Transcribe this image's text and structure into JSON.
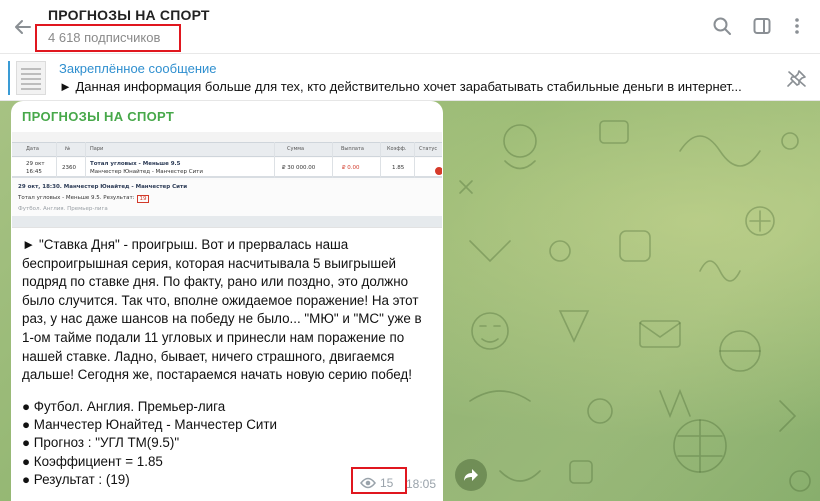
{
  "header": {
    "title": "ПРОГНОЗЫ НА СПОРТ",
    "subscribers": "4 618 подписчиков",
    "icons": [
      "arrow-left-icon",
      "search-icon",
      "sidebar-toggle-icon",
      "more-vertical-icon"
    ]
  },
  "pinned": {
    "title": "Закреплённое сообщение",
    "text": "► Данная информация больше для тех, кто действительно хочет зарабатывать стабильные деньги в интернет..."
  },
  "message": {
    "author": "ПРОГНОЗЫ НА СПОРТ",
    "photo": {
      "headers": [
        "Дата",
        "№",
        "Пари",
        "Сумма",
        "Выплата",
        "Коэфф.",
        "Статус"
      ],
      "row": {
        "date": "29 окт",
        "time": "16:45",
        "number": "2360",
        "bet": "Тотал угловых - Меньше 9.5",
        "match": "Манчестер Юнайтед - Манчестер Сити",
        "amount": "₽ 30 000.00",
        "payout": "₽ 0.00",
        "coef": "1.85"
      },
      "detail_title": "29 окт, 18:30. Манчестер Юнайтед - Манчестер Сити",
      "detail_bet": "Тотал угловых - Меньше 9.5. Результат:",
      "detail_result": "19",
      "detail_league": "Футбол. Англия. Премьер-лига"
    },
    "paragraph": "► \"Ставка Дня\" - проигрыш. Вот и прервалась наша беспроигрышная серия, которая насчитывала 5 выигрышей подряд по ставке дня. По факту, рано или поздно, это должно было случится. Так что, вполне ожидаемое поражение! На этот раз, у нас даже шансов на победу не было... \"МЮ\" и \"МС\" уже в 1-ом тайме подали 11 угловых и принесли нам поражение по нашей ставке. Ладно, бывает, ничего страшного, двигаемся дальше! Сегодня же, постараемся начать новую серию побед!",
    "list": [
      "● Футбол. Англия. Премьер-лига",
      "● Манчестер Юнайтед - Манчестер Сити",
      "● Прогноз : \"УГЛ ТМ(9.5)\"",
      "● Коэффициент = 1.85",
      "● Результат : (19)"
    ],
    "views": "15",
    "time": "18:05"
  },
  "colors": {
    "author": "#47a84a",
    "link": "#2f8fcf",
    "highlight_box": "#e0171f",
    "chat_bg": "#9cbc79"
  }
}
